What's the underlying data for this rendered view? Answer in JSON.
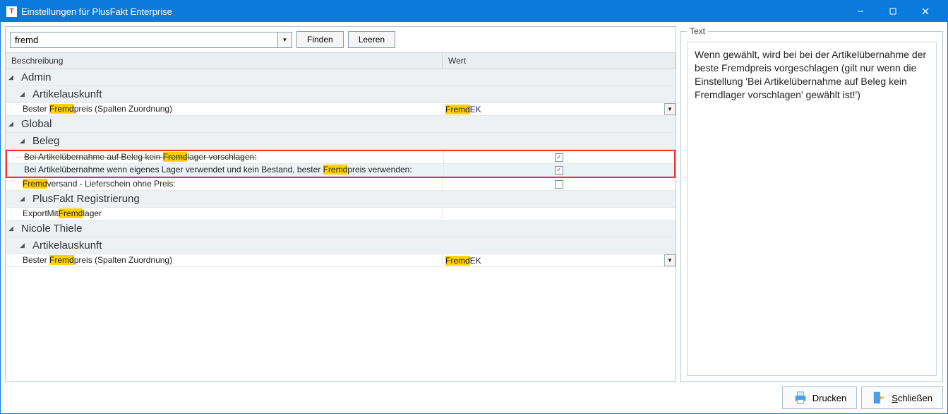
{
  "window": {
    "title": "Einstellungen für PlusFakt Enterprise"
  },
  "search": {
    "value": "fremd",
    "find_label": "Finden",
    "clear_label": "Leeren"
  },
  "columns": {
    "desc": "Beschreibung",
    "wert": "Wert"
  },
  "groups": {
    "admin": "Admin",
    "artikelauskunft1": "Artikelauskunft",
    "global": "Global",
    "beleg": "Beleg",
    "plusfakt_reg": "PlusFakt Registrierung",
    "nicole": "Nicole Thiele",
    "artikelauskunft2": "Artikelauskunft"
  },
  "rows": {
    "r1_pre": "Bester ",
    "r1_hl": "Fremd",
    "r1_post": "preis (Spalten Zuordnung)",
    "r1_wert_hl": "Fremd",
    "r1_wert_post": "EK",
    "r2_pre": "Bei Artikelübernahme auf Beleg kein ",
    "r2_hl": "Fremd",
    "r2_post": "lager vorschlagen:",
    "r3_pre": "Bei Artikelübernahme wenn eigenes Lager verwendet und kein Bestand, bester ",
    "r3_hl": "Fremd",
    "r3_post": "preis verwenden:",
    "r4_hl": "Fremd",
    "r4_post": "versand - Lieferschein ohne Preis:",
    "r5_pre": "ExportMit",
    "r5_hl": "Fremd",
    "r5_post": "lager",
    "r6_pre": "Bester ",
    "r6_hl": "Fremd",
    "r6_post": "preis (Spalten Zuordnung)",
    "r6_wert_hl": "Fremd",
    "r6_wert_post": "EK"
  },
  "text_panel": {
    "legend": "Text",
    "content": "Wenn gewählt, wird bei bei der Artikelübernahme der beste Fremdpreis vorgeschlagen (gilt nur wenn die Einstellung 'Bei Artikelübernahme auf Beleg kein Fremdlager vorschlagen' gewählt ist!')"
  },
  "footer": {
    "print": "Drucken",
    "close": "Schließen"
  }
}
